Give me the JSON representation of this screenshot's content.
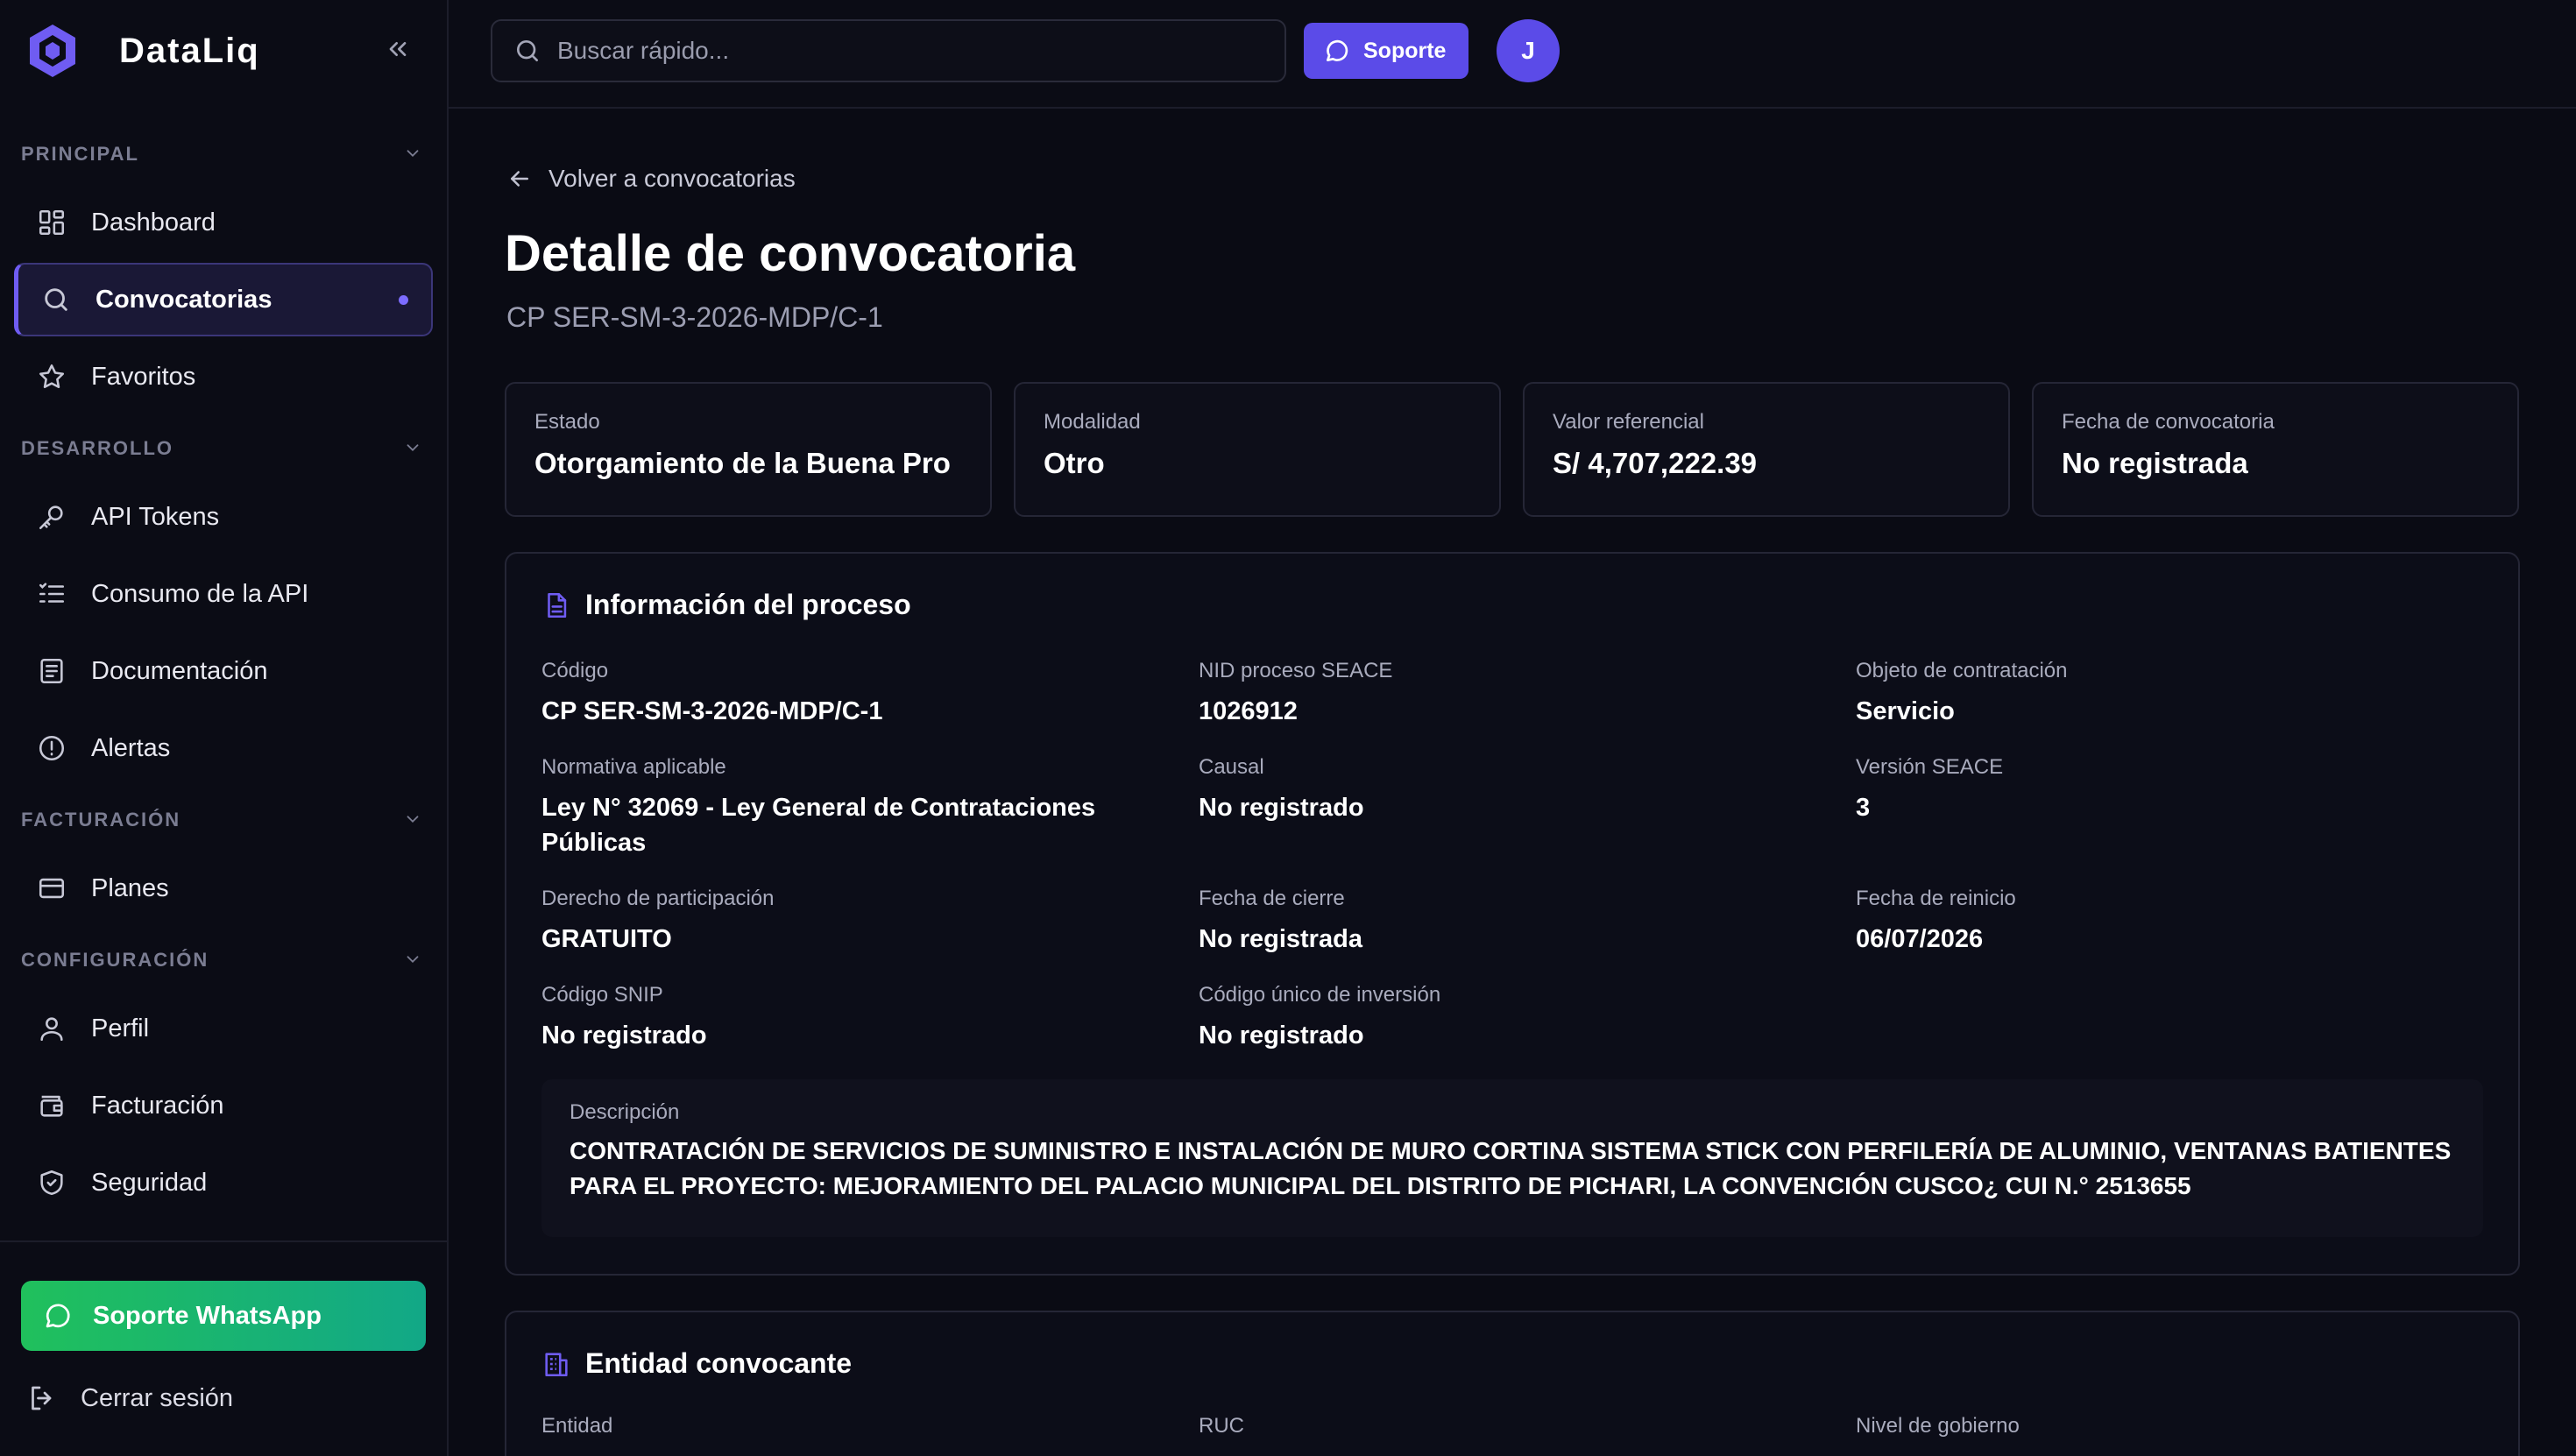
{
  "brand": {
    "name": "DataLiq"
  },
  "sidebar": {
    "sections": [
      {
        "label": "PRINCIPAL",
        "items": [
          {
            "label": "Dashboard",
            "icon": "dashboard-icon"
          },
          {
            "label": "Convocatorias",
            "icon": "search-icon",
            "active": true
          },
          {
            "label": "Favoritos",
            "icon": "star-icon"
          }
        ]
      },
      {
        "label": "DESARROLLO",
        "items": [
          {
            "label": "API Tokens",
            "icon": "key-icon"
          },
          {
            "label": "Consumo de la API",
            "icon": "list-icon"
          },
          {
            "label": "Documentación",
            "icon": "document-icon"
          },
          {
            "label": "Alertas",
            "icon": "alert-icon"
          }
        ]
      },
      {
        "label": "FACTURACIÓN",
        "items": [
          {
            "label": "Planes",
            "icon": "credit-card-icon"
          }
        ]
      },
      {
        "label": "CONFIGURACIÓN",
        "items": [
          {
            "label": "Perfil",
            "icon": "user-icon"
          },
          {
            "label": "Facturación",
            "icon": "wallet-icon"
          },
          {
            "label": "Seguridad",
            "icon": "shield-icon"
          }
        ]
      }
    ],
    "whatsapp_label": "Soporte WhatsApp",
    "logout_label": "Cerrar sesión"
  },
  "topbar": {
    "search_placeholder": "Buscar rápido...",
    "support_label": "Soporte",
    "avatar_initial": "J"
  },
  "main": {
    "back_label": "Volver a convocatorias",
    "title": "Detalle de convocatoria",
    "subtitle": "CP SER-SM-3-2026-MDP/C-1",
    "stats": [
      {
        "label": "Estado",
        "value": "Otorgamiento de la Buena Pro"
      },
      {
        "label": "Modalidad",
        "value": "Otro"
      },
      {
        "label": "Valor referencial",
        "value": "S/ 4,707,222.39"
      },
      {
        "label": "Fecha de convocatoria",
        "value": "No registrada"
      }
    ],
    "process": {
      "title": "Información del proceso",
      "fields": [
        {
          "label": "Código",
          "value": "CP SER-SM-3-2026-MDP/C-1"
        },
        {
          "label": "NID proceso SEACE",
          "value": "1026912"
        },
        {
          "label": "Objeto de contratación",
          "value": "Servicio"
        },
        {
          "label": "Normativa aplicable",
          "value": "Ley N° 32069 - Ley General de Contrataciones Públicas"
        },
        {
          "label": "Causal",
          "value": "No registrado"
        },
        {
          "label": "Versión SEACE",
          "value": "3"
        },
        {
          "label": "Derecho de participación",
          "value": "GRATUITO"
        },
        {
          "label": "Fecha de cierre",
          "value": "No registrada"
        },
        {
          "label": "Fecha de reinicio",
          "value": "06/07/2026"
        },
        {
          "label": "Código SNIP",
          "value": "No registrado"
        },
        {
          "label": "Código único de inversión",
          "value": "No registrado"
        }
      ],
      "description_label": "Descripción",
      "description": "CONTRATACIÓN DE SERVICIOS DE SUMINISTRO E INSTALACIÓN DE MURO CORTINA SISTEMA STICK CON PERFILERÍA DE ALUMINIO, VENTANAS BATIENTES PARA EL PROYECTO: MEJORAMIENTO DEL PALACIO MUNICIPAL DEL DISTRITO DE PICHARI, LA CONVENCIÓN CUSCO¿ CUI N.° 2513655"
    },
    "entity": {
      "title": "Entidad convocante",
      "fields": [
        {
          "label": "Entidad"
        },
        {
          "label": "RUC"
        },
        {
          "label": "Nivel de gobierno"
        }
      ]
    }
  },
  "colors": {
    "accent": "#5b4be8",
    "whatsapp": "#20c05c",
    "background": "#0a0b14"
  }
}
